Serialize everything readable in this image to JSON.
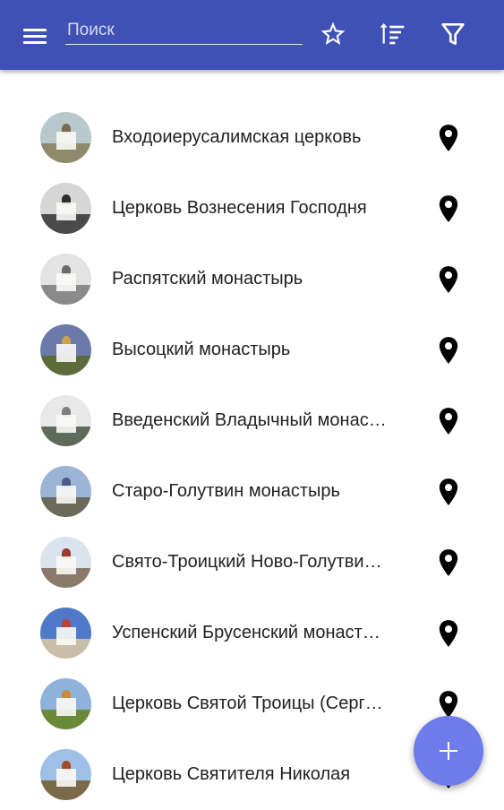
{
  "colors": {
    "app_bar": "#3f51b5",
    "fab": "#6d7ce8",
    "text": "#212121",
    "icon": "#000000"
  },
  "toolbar": {
    "menu_icon": "menu-icon",
    "search_placeholder": "Поиск",
    "search_value": "",
    "favorites_icon": "star-outline-icon",
    "sort_icon": "sort-icon",
    "filter_icon": "filter-icon"
  },
  "items": [
    {
      "title": "Входоиерусалимская церковь",
      "thumb": {
        "sky": "#b9c7cf",
        "ground": "#8f8a6a",
        "dome": "#7a6b4a"
      }
    },
    {
      "title": "Церковь Вознесения Господня",
      "thumb": {
        "sky": "#d6d6d6",
        "ground": "#4a4a4a",
        "dome": "#2e2e2e"
      }
    },
    {
      "title": "Распятский монастырь",
      "thumb": {
        "sky": "#e3e3e3",
        "ground": "#8a8a8a",
        "dome": "#6a6a6a"
      }
    },
    {
      "title": "Высоцкий монастырь",
      "thumb": {
        "sky": "#6b7aa8",
        "ground": "#5b6b3a",
        "dome": "#c9a24a"
      }
    },
    {
      "title": "Введенский Владычный монастырь",
      "thumb": {
        "sky": "#e8e8e8",
        "ground": "#5e6a5a",
        "dome": "#7d7d7d"
      }
    },
    {
      "title": "Старо-Голутвин монастырь",
      "thumb": {
        "sky": "#9bb3d4",
        "ground": "#6a6a5a",
        "dome": "#4d5a8a"
      }
    },
    {
      "title": "Свято-Троицкий Ново-Голутвин монастырь",
      "thumb": {
        "sky": "#d9e4ee",
        "ground": "#8a7a6a",
        "dome": "#9a3a2a"
      }
    },
    {
      "title": "Успенский Брусенский монастырь",
      "thumb": {
        "sky": "#4f79c8",
        "ground": "#c9bfa8",
        "dome": "#b8433a"
      }
    },
    {
      "title": "Церковь Святой Троицы (Сергиевская)",
      "thumb": {
        "sky": "#8fb2dc",
        "ground": "#6a8a3a",
        "dome": "#c98a3a"
      }
    },
    {
      "title": "Церковь Святителя Николая",
      "thumb": {
        "sky": "#9ec0e6",
        "ground": "#7a6a4a",
        "dome": "#a24a2a"
      }
    }
  ],
  "item_action_icon": "location-pin-icon",
  "fab": {
    "label": "+",
    "icon": "add-icon"
  }
}
